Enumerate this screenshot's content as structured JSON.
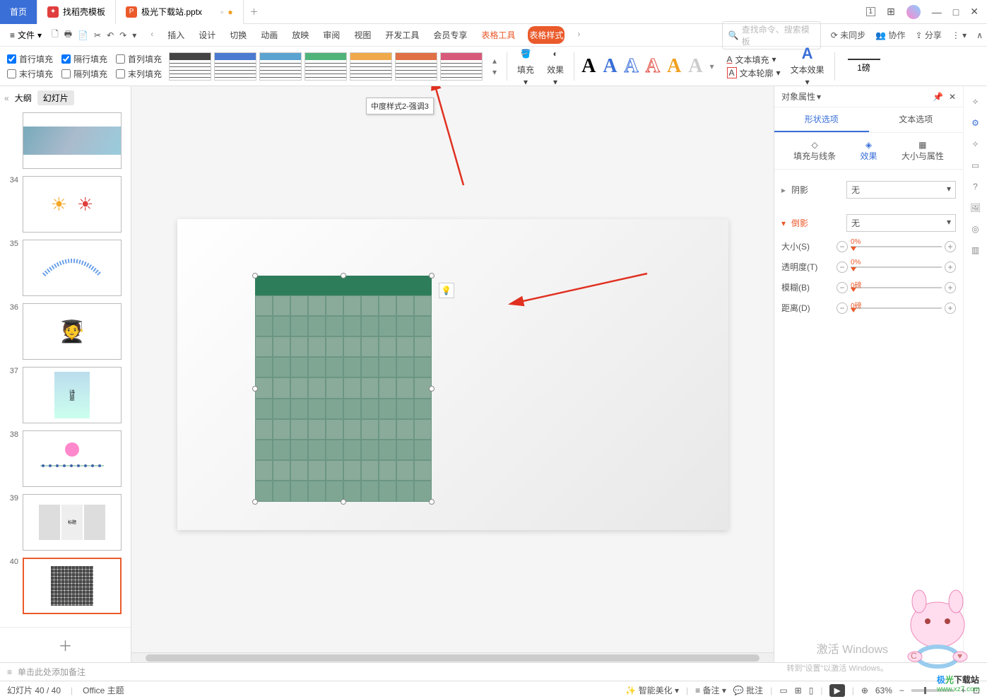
{
  "tabs": {
    "home": "首页",
    "template": "找稻壳模板",
    "doc": "极光下载站.pptx"
  },
  "menu": {
    "file": "文件",
    "insert": "插入",
    "design": "设计",
    "transition": "切换",
    "animation": "动画",
    "slideshow": "放映",
    "review": "审阅",
    "view": "视图",
    "devtools": "开发工具",
    "vip": "会员专享",
    "tabletool": "表格工具",
    "tablestyle": "表格样式"
  },
  "search": {
    "placeholder": "查找命令、搜索模板"
  },
  "topright": {
    "sync": "未同步",
    "coop": "协作",
    "share": "分享"
  },
  "checks": {
    "r1c1": "首行填充",
    "r1c2": "隔行填充",
    "r1c3": "首列填充",
    "r2c1": "末行填充",
    "r2c2": "隔列填充",
    "r2c3": "末列填充"
  },
  "ribbon": {
    "fill": "填充",
    "effect": "效果",
    "textfill": "文本填充",
    "textoutline": "文本轮廓",
    "texteffect": "文本效果",
    "linewidth": "1磅"
  },
  "tooltip": "中度样式2-强调3",
  "side": {
    "outline": "大纲",
    "slides": "幻灯片"
  },
  "thumbs": [
    {
      "n": ""
    },
    {
      "n": "34"
    },
    {
      "n": "35"
    },
    {
      "n": "36"
    },
    {
      "n": "37"
    },
    {
      "n": "38"
    },
    {
      "n": "39"
    },
    {
      "n": "40"
    }
  ],
  "rpanel": {
    "title": "对象属性",
    "shapetab": "形状选项",
    "texttab": "文本选项",
    "fillline": "填充与线条",
    "effects": "效果",
    "sizeprops": "大小与属性",
    "shadow": "阴影",
    "reflection": "倒影",
    "none": "无",
    "size": "大小(S)",
    "size_v": "0%",
    "transparency": "透明度(T)",
    "trans_v": "0%",
    "blur": "模糊(B)",
    "blur_v": "0磅",
    "distance": "距离(D)",
    "dist_v": "0磅"
  },
  "notes": "单击此处添加备注",
  "status": {
    "slide": "幻灯片 40 / 40",
    "theme": "Office 主题",
    "beautify": "智能美化",
    "notes": "备注",
    "comments": "批注",
    "zoom": "63%"
  },
  "watermark": {
    "l1": "激活 Windows",
    "l2": "转到\"设置\"以激活 Windows。"
  },
  "logo": {
    "name": "极光下载站",
    "url": "www.xz7.com"
  },
  "stylecolors": [
    "#444",
    "#4a7bd0",
    "#5aa3d0",
    "#4fb37a",
    "#f0a94a",
    "#e07046",
    "#d85a7a"
  ]
}
